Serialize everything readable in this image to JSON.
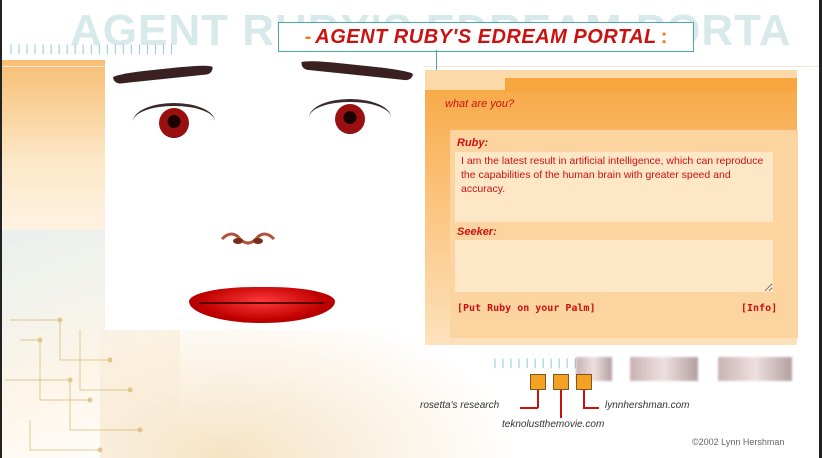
{
  "title": {
    "text": "AGENT RUBY'S EDREAM PORTAL",
    "watermark": "AGENT RUBY'S EDREAM PORTA",
    "left_mark": "-",
    "right_mark": ":"
  },
  "chat": {
    "question": "what are you?",
    "ruby_label": "Ruby:",
    "ruby_answer": "I am the latest result in artificial intelligence, which can reproduce the capabilities of the human brain with greater speed and accuracy.",
    "seeker_label": "Seeker:",
    "seeker_value": ""
  },
  "links": {
    "palm": "[Put Ruby on your Palm]",
    "info": "[Info]",
    "rosetta": "rosetta's research",
    "teknolust": "teknolustthemovie.com",
    "lynn": "lynnhershman.com"
  },
  "footer": {
    "copyright": "©2002 Lynn Hershman"
  },
  "decor": {
    "top_dots": "|||||||||||||||||||||",
    "bottom_dots": "|||||||||||"
  },
  "colors": {
    "accent_red": "#cc1111",
    "panel_orange": "#f7a640",
    "teal": "#4aa6a8"
  }
}
